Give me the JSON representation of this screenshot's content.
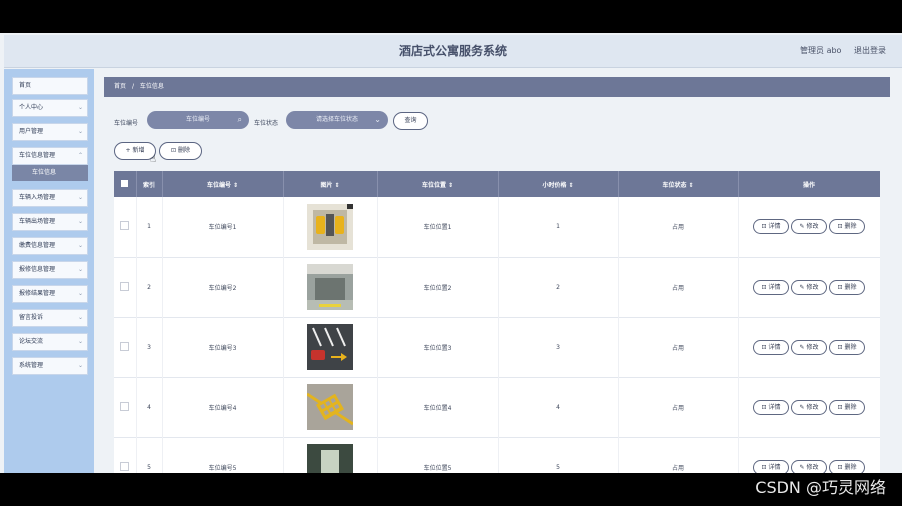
{
  "app": {
    "title": "酒店式公寓服务系统",
    "user": "管理员 abo",
    "logout": "退出登录"
  },
  "sidebar": {
    "items": [
      {
        "label": "首页",
        "chevron": false
      },
      {
        "label": "个人中心",
        "chevron": true
      },
      {
        "label": "用户管理",
        "chevron": true
      },
      {
        "label": "车位信息管理",
        "chevron": true
      },
      {
        "label": "车辆入场管理",
        "chevron": true
      },
      {
        "label": "车辆出场管理",
        "chevron": true
      },
      {
        "label": "缴费信息管理",
        "chevron": true
      },
      {
        "label": "报修信息管理",
        "chevron": true
      },
      {
        "label": "报修结果管理",
        "chevron": true
      },
      {
        "label": "留言投诉",
        "chevron": true
      },
      {
        "label": "论坛交流",
        "chevron": true
      },
      {
        "label": "系统管理",
        "chevron": true
      }
    ],
    "active_sub": "车位信息"
  },
  "breadcrumb": {
    "home": "首页",
    "sep": "/",
    "current": "车位信息"
  },
  "search": {
    "number_label": "车位编号",
    "number_placeholder": "车位编号",
    "status_label": "车位状态",
    "status_placeholder": "请选择车位状态",
    "query": "查询"
  },
  "actions": {
    "add": "+ 新增",
    "delete": "删除"
  },
  "table": {
    "headers": [
      "索引",
      "车位编号 ⇕",
      "图片 ⇕",
      "车位位置 ⇕",
      "小时价格 ⇕",
      "车位状态 ⇕",
      "操作"
    ],
    "rows": [
      {
        "index": "1",
        "number": "车位编号1",
        "position": "车位位置1",
        "price": "1",
        "status": "占用"
      },
      {
        "index": "2",
        "number": "车位编号2",
        "position": "车位位置2",
        "price": "2",
        "status": "占用"
      },
      {
        "index": "3",
        "number": "车位编号3",
        "position": "车位位置3",
        "price": "3",
        "status": "占用"
      },
      {
        "index": "4",
        "number": "车位编号4",
        "position": "车位位置4",
        "price": "4",
        "status": "占用"
      },
      {
        "index": "5",
        "number": "车位编号5",
        "position": "车位位置5",
        "price": "5",
        "status": "占用"
      }
    ],
    "row_actions": {
      "detail": "详情",
      "edit": "修改",
      "delete": "删除"
    }
  },
  "watermark": "CSDN @巧灵网络",
  "colors": {
    "accent": "#6d7797",
    "sidebar": "#aecbed",
    "header": "#dfe7f1"
  }
}
